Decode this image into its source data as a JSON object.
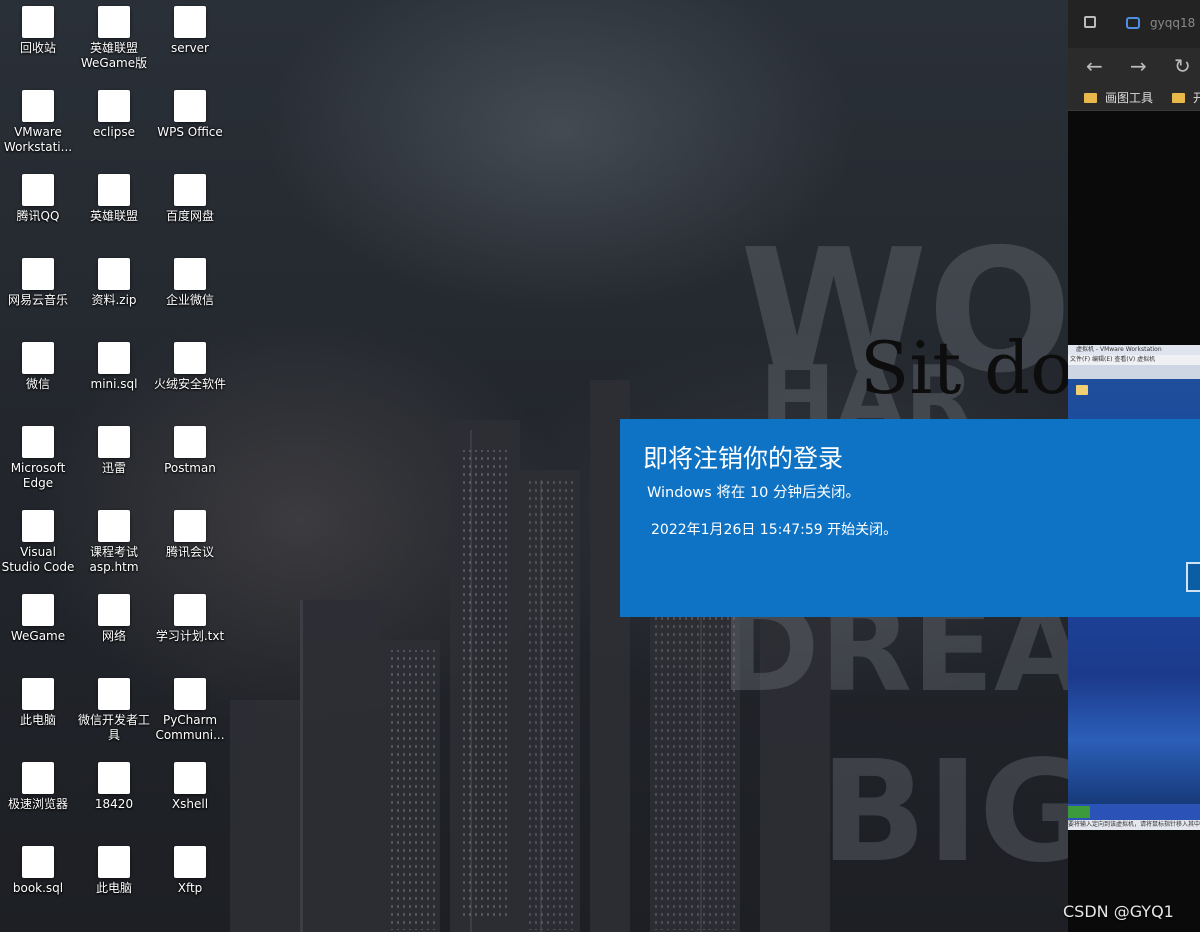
{
  "desktop": {
    "icons": [
      {
        "label": "回收站",
        "icon": "recycle-bin-icon",
        "color": "#8fa7c4"
      },
      {
        "label": "英雄联盟\nWeGame版",
        "icon": "league-of-legends-icon",
        "color": "#2a3f6e"
      },
      {
        "label": "server",
        "icon": "zip-folder-icon",
        "color": "#d8b24a"
      },
      {
        "label": "VMware\nWorkstati...",
        "icon": "vmware-icon",
        "color": "#4a8fd8"
      },
      {
        "label": "eclipse",
        "icon": "eclipse-icon",
        "color": "#2c2a5e"
      },
      {
        "label": "WPS Office",
        "icon": "wps-office-icon",
        "color": "#d42f2f"
      },
      {
        "label": "腾讯QQ",
        "icon": "qq-penguin-icon",
        "color": "#1b1b1b"
      },
      {
        "label": "英雄联盟",
        "icon": "league-of-legends-icon",
        "color": "#2a3f6e"
      },
      {
        "label": "百度网盘",
        "icon": "baidu-netdisk-icon",
        "color": "#4a9de0"
      },
      {
        "label": "网易云音乐",
        "icon": "netease-music-icon",
        "color": "#d12a2a"
      },
      {
        "label": "资料.zip",
        "icon": "winrar-archive-icon",
        "color": "#8b3a8f"
      },
      {
        "label": "企业微信",
        "icon": "wecom-icon",
        "color": "#3c8ad8"
      },
      {
        "label": "微信",
        "icon": "wechat-icon",
        "color": "#3bb54a"
      },
      {
        "label": "mini.sql",
        "icon": "sql-file-icon",
        "color": "#d64b6a"
      },
      {
        "label": "火绒安全软件",
        "icon": "huorong-security-icon",
        "color": "#e58a2a"
      },
      {
        "label": "Microsoft\nEdge",
        "icon": "edge-browser-icon",
        "color": "#2b8fd8"
      },
      {
        "label": "迅雷",
        "icon": "xunlei-bird-icon",
        "color": "#2b6fd6"
      },
      {
        "label": "Postman",
        "icon": "postman-icon",
        "color": "#e8672b"
      },
      {
        "label": "Visual\nStudio Code",
        "icon": "vscode-icon",
        "color": "#2b7fd0"
      },
      {
        "label": "课程考试\nasp.htm",
        "icon": "edge-html-file-icon",
        "color": "#2b8fd8"
      },
      {
        "label": "腾讯会议",
        "icon": "tencent-meeting-icon",
        "color": "#2b6fd6"
      },
      {
        "label": "WeGame",
        "icon": "wegame-icon",
        "color": "#c49a2a"
      },
      {
        "label": "网络",
        "icon": "network-icon",
        "color": "#4a8fd0"
      },
      {
        "label": "学习计划.txt",
        "icon": "text-file-icon",
        "color": "#d8d8d8"
      },
      {
        "label": "此电脑",
        "icon": "this-pc-icon",
        "color": "#3c8ad8"
      },
      {
        "label": "微信开发者工\n具",
        "icon": "wechat-devtools-icon",
        "color": "#5ab56a"
      },
      {
        "label": "PyCharm\nCommuni...",
        "icon": "pycharm-icon",
        "color": "#1a1a1a"
      },
      {
        "label": "极速浏览器",
        "icon": "speed-browser-icon",
        "color": "#e04a3a"
      },
      {
        "label": "18420",
        "icon": "user-folder-icon",
        "color": "#d8b24a"
      },
      {
        "label": "Xshell",
        "icon": "xshell-icon",
        "color": "#d83a2a"
      },
      {
        "label": "book.sql",
        "icon": "sql-file-icon",
        "color": "#d64b6a"
      },
      {
        "label": "此电脑",
        "icon": "this-pc-icon",
        "color": "#3c8ad8"
      },
      {
        "label": "Xftp",
        "icon": "xftp-icon",
        "color": "#4aa84a"
      }
    ]
  },
  "wallpaper": {
    "lines": [
      "WOR",
      "Sit do"
    ]
  },
  "browser": {
    "tab_title": "gyqq18",
    "nav_back": "←",
    "nav_forward": "→",
    "nav_reload": "↻",
    "bookmarks": [
      "画图工具",
      "开"
    ]
  },
  "vmware": {
    "title": "虚拟机 - VMware Workstation",
    "menu": "文件(F)  编辑(E)  查看(V)  虚拟机",
    "status": "要将输入定向到该虚拟机，请将鼠标指针移入其中"
  },
  "notice": {
    "title": "即将注销你的登录",
    "message": "Windows 将在 10 分钟后关闭。",
    "time": "2022年1月26日 15:47:59 开始关闭。",
    "background": "#0e73c4"
  },
  "watermark": "CSDN @GYQ1"
}
